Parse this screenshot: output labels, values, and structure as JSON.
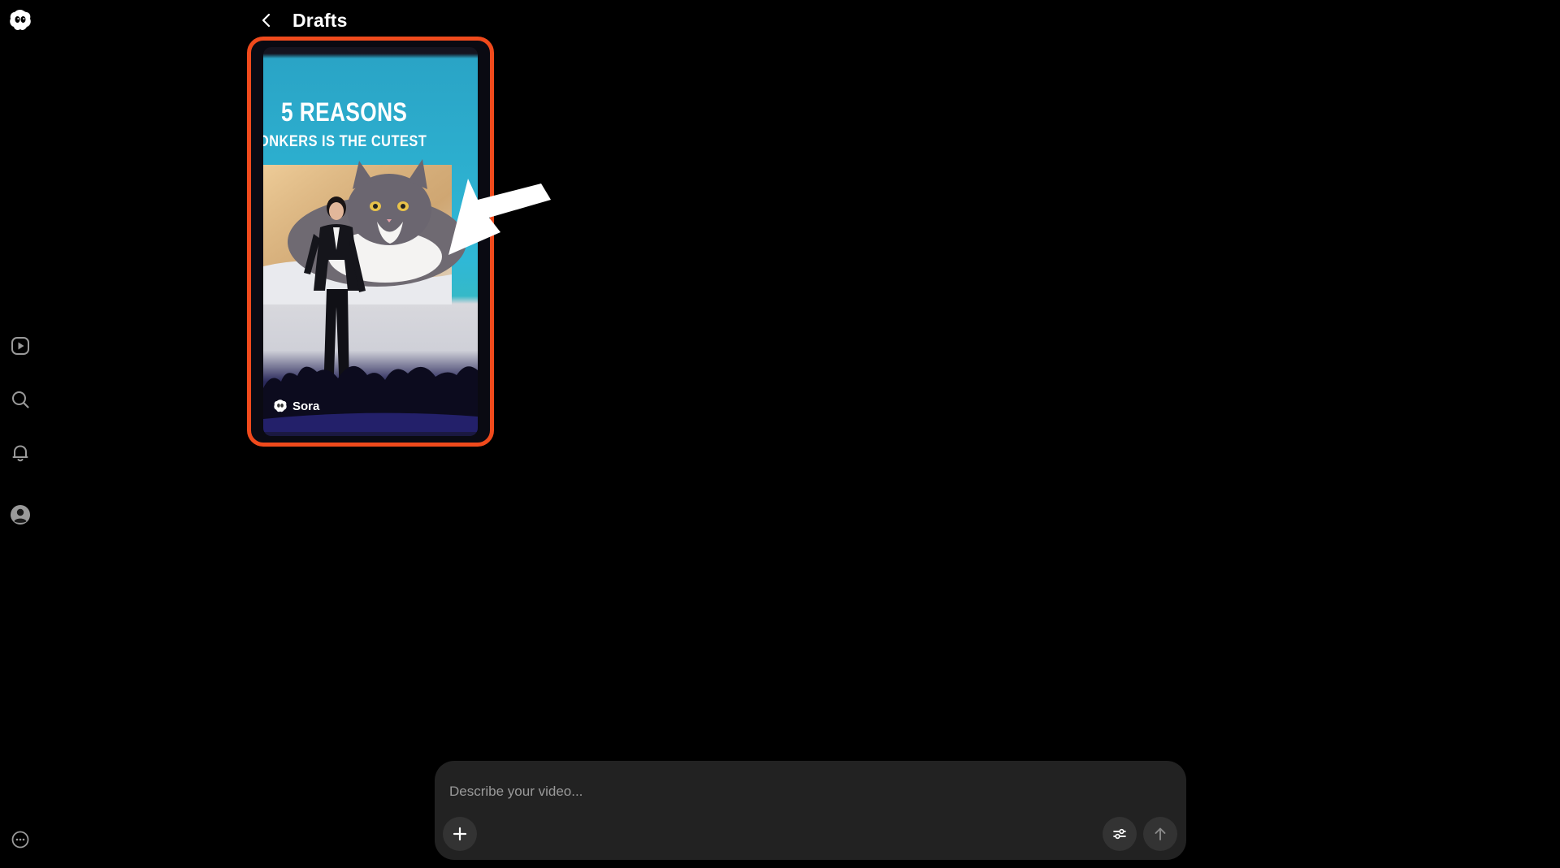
{
  "header": {
    "title": "Drafts"
  },
  "sidebar": {
    "items": [
      {
        "name": "app-logo",
        "icon": "sora-logo-icon"
      },
      {
        "name": "sidebar-item-videos",
        "icon": "play-icon"
      },
      {
        "name": "sidebar-item-search",
        "icon": "search-icon"
      },
      {
        "name": "sidebar-item-notifications",
        "icon": "bell-icon"
      },
      {
        "name": "sidebar-item-profile",
        "icon": "user-icon"
      },
      {
        "name": "sidebar-item-more",
        "icon": "more-icon"
      }
    ]
  },
  "drafts": [
    {
      "headline": "5 REASONS",
      "subline": "ONKERS IS THE CUTEST",
      "brand": "Sora"
    }
  ],
  "composer": {
    "placeholder": "Describe your video..."
  },
  "colors": {
    "background": "#000000",
    "highlight_border": "#f04a1c",
    "composer_bg": "#222222",
    "button_bg": "#333333"
  }
}
